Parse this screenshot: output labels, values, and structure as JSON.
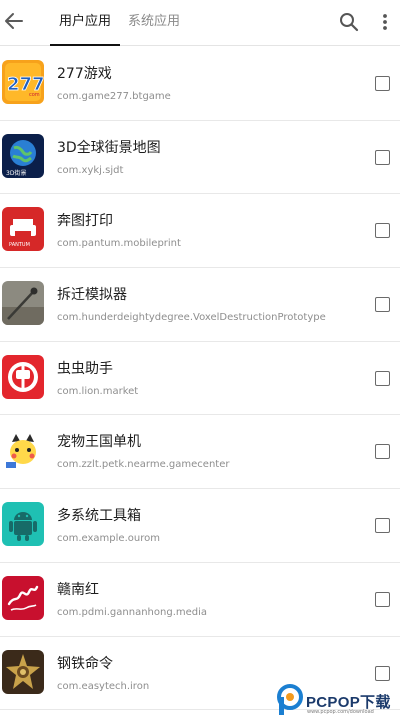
{
  "header": {
    "tabs": [
      {
        "label": "用户应用",
        "active": true
      },
      {
        "label": "系统应用",
        "active": false
      }
    ]
  },
  "apps": [
    {
      "name": "277游戏",
      "package": "com.game277.btgame",
      "icon": "277-game-icon",
      "checked": false
    },
    {
      "name": "3D全球街景地图",
      "package": "com.xykj.sjdt",
      "icon": "globe-street-map-icon",
      "checked": false
    },
    {
      "name": "奔图打印",
      "package": "com.pantum.mobileprint",
      "icon": "printer-icon",
      "checked": false
    },
    {
      "name": "拆迁模拟器",
      "package": "com.hunderdeightydegree.VoxelDestructionPrototype",
      "icon": "demolition-icon",
      "checked": false
    },
    {
      "name": "虫虫助手",
      "package": "com.lion.market",
      "icon": "chongchong-icon",
      "checked": false
    },
    {
      "name": "宠物王国单机",
      "package": "com.zzlt.petk.nearme.gamecenter",
      "icon": "pet-kingdom-icon",
      "checked": false
    },
    {
      "name": "多系统工具箱",
      "package": "com.example.ourom",
      "icon": "android-toolbox-icon",
      "checked": false
    },
    {
      "name": "赣南红",
      "package": "com.pdmi.gannanhong.media",
      "icon": "gannanhong-icon",
      "checked": false
    },
    {
      "name": "钢铁命令",
      "package": "com.easytech.iron",
      "icon": "iron-command-icon",
      "checked": false
    }
  ],
  "watermark": {
    "brand": "PCPOP下载",
    "sub": "www.pcpop.com/download"
  },
  "colors": {
    "accent": "#111111",
    "text_secondary": "#8e8e8e",
    "divider": "#e8e8e8"
  }
}
